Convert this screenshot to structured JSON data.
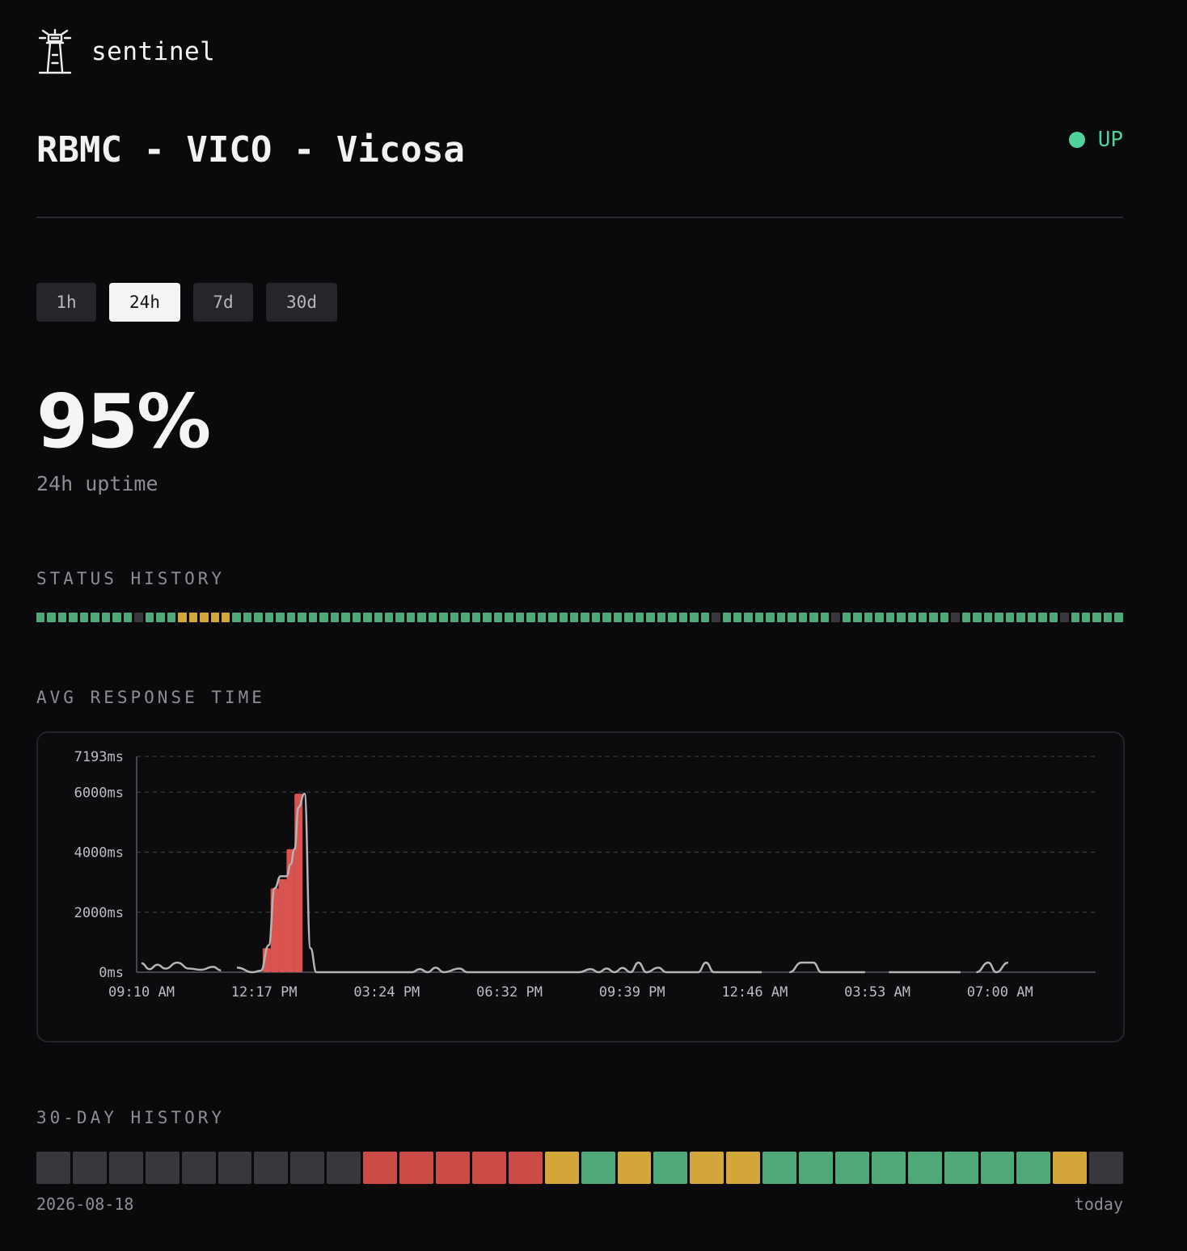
{
  "app": {
    "name": "sentinel"
  },
  "monitor": {
    "title": "RBMC - VICO - Vicosa",
    "status": "UP"
  },
  "colors": {
    "up": "#4fa877",
    "warn": "#d3a63b",
    "down": "#cb4c47",
    "nodata": "#38383c",
    "status_text": "#4fd39a"
  },
  "tabs": [
    {
      "label": "1h",
      "active": false
    },
    {
      "label": "24h",
      "active": true
    },
    {
      "label": "7d",
      "active": false
    },
    {
      "label": "30d",
      "active": false
    }
  ],
  "uptime": {
    "value": "95%",
    "label": "24h uptime"
  },
  "status_history": {
    "label": "STATUS HISTORY",
    "states": [
      "up",
      "up",
      "up",
      "up",
      "up",
      "up",
      "up",
      "up",
      "up",
      "nodata",
      "up",
      "up",
      "up",
      "warn",
      "warn",
      "warn",
      "warn",
      "warn",
      "up",
      "up",
      "up",
      "up",
      "up",
      "up",
      "up",
      "up",
      "up",
      "up",
      "up",
      "up",
      "up",
      "up",
      "up",
      "up",
      "up",
      "up",
      "up",
      "up",
      "up",
      "up",
      "up",
      "up",
      "up",
      "up",
      "up",
      "up",
      "up",
      "up",
      "up",
      "up",
      "up",
      "up",
      "up",
      "up",
      "up",
      "up",
      "up",
      "up",
      "up",
      "up",
      "up",
      "up",
      "nodata",
      "up",
      "up",
      "up",
      "up",
      "up",
      "up",
      "up",
      "up",
      "up",
      "up",
      "nodata",
      "up",
      "up",
      "up",
      "up",
      "up",
      "up",
      "up",
      "up",
      "up",
      "up",
      "nodata",
      "up",
      "up",
      "up",
      "up",
      "up",
      "up",
      "up",
      "up",
      "up",
      "nodata",
      "up",
      "up",
      "up",
      "up",
      "up"
    ]
  },
  "chart_data": {
    "type": "line",
    "title": "AVG RESPONSE TIME",
    "x_ticks": [
      "09:10 AM",
      "12:17 PM",
      "03:24 PM",
      "06:32 PM",
      "09:39 PM",
      "12:46 AM",
      "03:53 AM",
      "07:00 AM"
    ],
    "y_ticks": [
      "0ms",
      "2000ms",
      "4000ms",
      "6000ms",
      "7193ms"
    ],
    "ylim": [
      0,
      7193
    ],
    "x_range_hours": [
      0,
      24
    ],
    "grid": "horizontal-dashed",
    "series": [
      {
        "values": [
          [
            0,
            300
          ],
          [
            0.2,
            100
          ],
          [
            0.4,
            250
          ],
          [
            0.6,
            120
          ],
          [
            0.9,
            320
          ],
          [
            1.2,
            120
          ],
          [
            1.5,
            80
          ],
          [
            1.8,
            180
          ],
          [
            2,
            60
          ],
          [
            null,
            null
          ],
          [
            2.4,
            150
          ],
          [
            2.8,
            0
          ],
          [
            3,
            50
          ],
          [
            3.2,
            900
          ],
          [
            3.35,
            2800
          ],
          [
            3.5,
            3200
          ],
          [
            3.65,
            3200
          ],
          [
            3.75,
            3600
          ],
          [
            3.85,
            4100
          ],
          [
            3.95,
            5500
          ],
          [
            4.1,
            5950
          ],
          [
            4.25,
            800
          ],
          [
            4.4,
            0
          ],
          [
            6.8,
            0
          ],
          [
            7,
            100
          ],
          [
            7.2,
            0
          ],
          [
            7.4,
            150
          ],
          [
            7.6,
            0
          ],
          [
            8,
            120
          ],
          [
            8.2,
            0
          ],
          [
            11,
            0
          ],
          [
            11.3,
            100
          ],
          [
            11.5,
            0
          ],
          [
            11.7,
            120
          ],
          [
            11.9,
            0
          ],
          [
            12.1,
            140
          ],
          [
            12.3,
            0
          ],
          [
            12.5,
            320
          ],
          [
            12.7,
            0
          ],
          [
            13,
            150
          ],
          [
            13.2,
            0
          ],
          [
            14,
            0
          ],
          [
            14.2,
            320
          ],
          [
            14.4,
            0
          ],
          [
            15.6,
            0
          ],
          [
            null,
            null
          ],
          [
            16.3,
            0
          ],
          [
            16.6,
            320
          ],
          [
            16.9,
            320
          ],
          [
            17.1,
            0
          ],
          [
            18.2,
            0
          ],
          [
            null,
            null
          ],
          [
            18.8,
            0
          ],
          [
            20.6,
            0
          ],
          [
            null,
            null
          ],
          [
            21,
            0
          ],
          [
            21.3,
            320
          ],
          [
            21.5,
            0
          ],
          [
            21.8,
            320
          ]
        ]
      }
    ],
    "bars": {
      "color": "#d9534f",
      "values": [
        [
          3.15,
          800
        ],
        [
          3.35,
          2800
        ],
        [
          3.55,
          3100
        ],
        [
          3.75,
          4100
        ],
        [
          3.95,
          5950
        ]
      ]
    }
  },
  "thirty_day": {
    "label": "30-DAY HISTORY",
    "start": "2026-08-18",
    "end": "today",
    "states": [
      "nodata",
      "nodata",
      "nodata",
      "nodata",
      "nodata",
      "nodata",
      "nodata",
      "nodata",
      "nodata",
      "down",
      "down",
      "down",
      "down",
      "down",
      "warn",
      "up",
      "warn",
      "up",
      "warn",
      "warn",
      "up",
      "up",
      "up",
      "up",
      "up",
      "up",
      "up",
      "up",
      "warn",
      "nodata"
    ]
  }
}
